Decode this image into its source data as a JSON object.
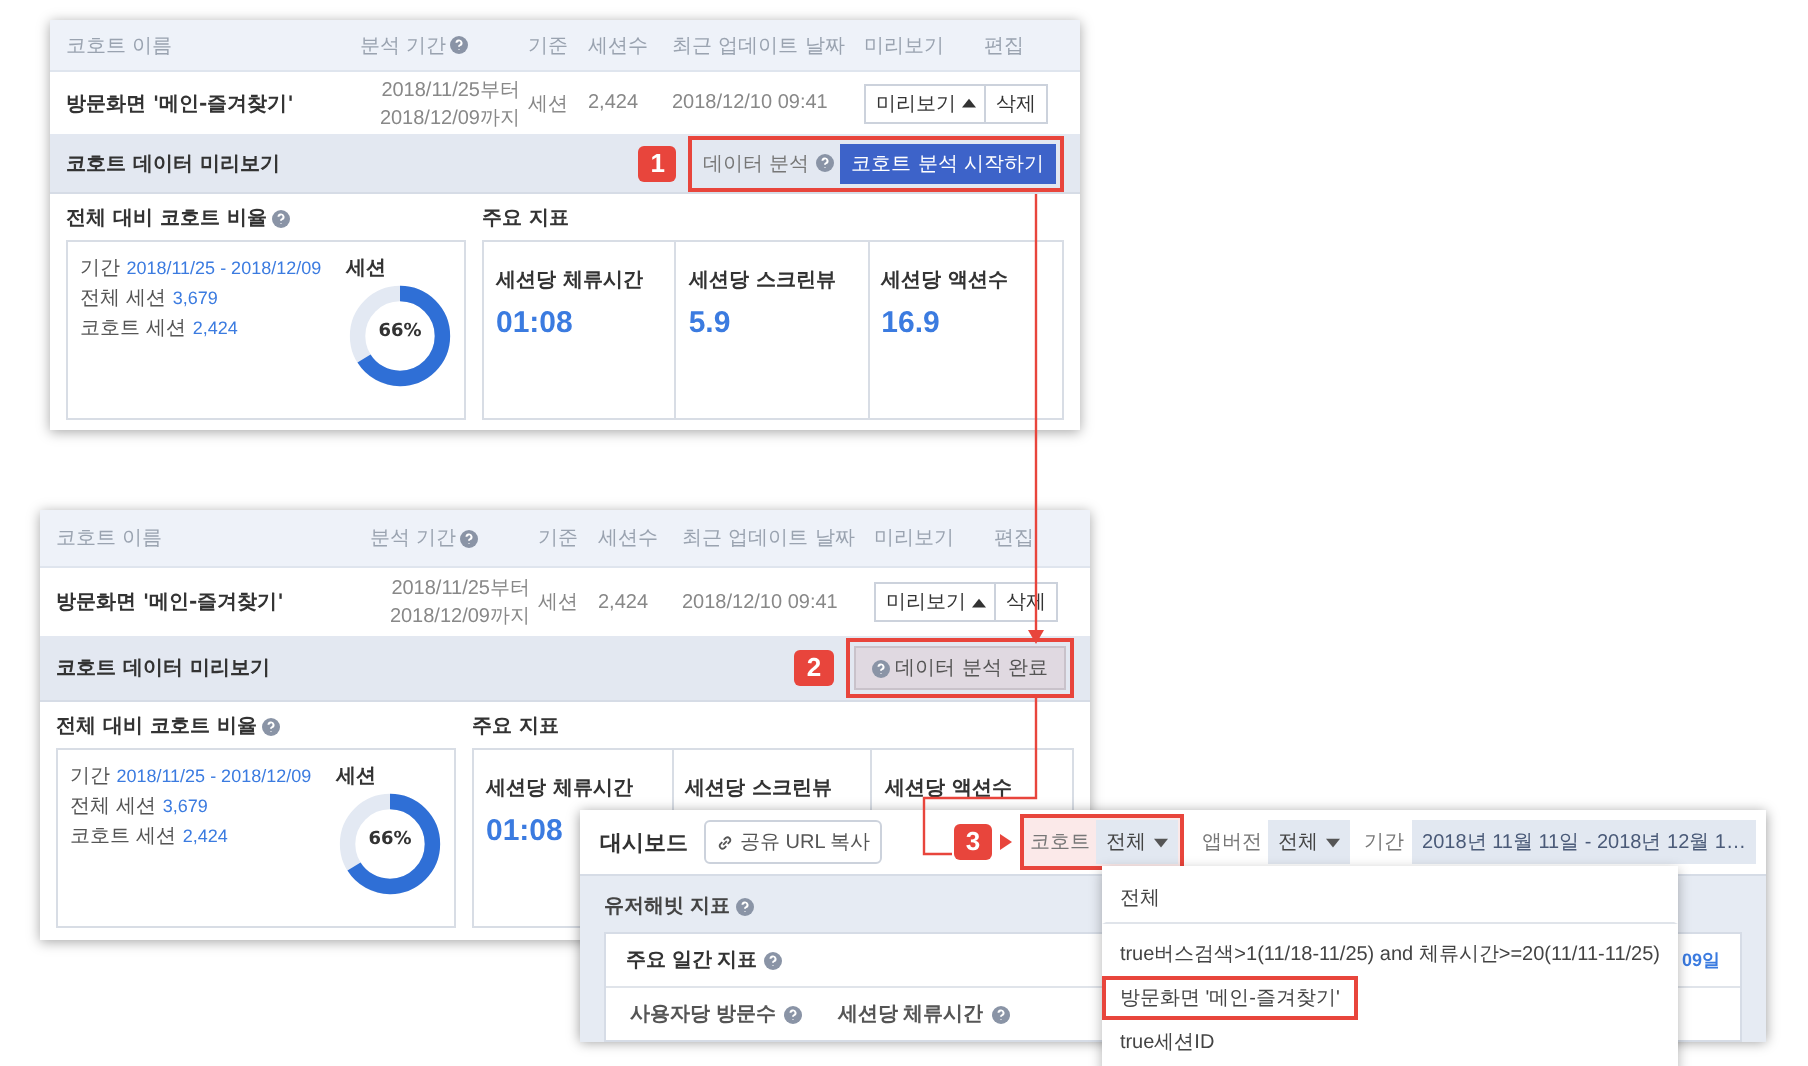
{
  "cohort_panels": [
    {
      "columns": [
        {
          "label": "코호트 이름",
          "help": false
        },
        {
          "label": "분석 기간",
          "help": true
        },
        {
          "label": "기준",
          "help": false
        },
        {
          "label": "세션수",
          "help": false
        },
        {
          "label": "최근 업데이트 날짜",
          "help": false
        },
        {
          "label": "미리보기",
          "help": false
        },
        {
          "label": "편집",
          "help": false
        }
      ],
      "row": {
        "name": "방문화면 '메인-즐겨찾기'",
        "period": [
          "2018/11/25부터",
          "2018/12/09까지"
        ],
        "basis": "세션",
        "sessions": "2,424",
        "updated": "2018/12/10 09:41",
        "preview_button": "미리보기",
        "delete_button": "삭제"
      },
      "section_title": "코호트 데이터 미리보기",
      "step": "1",
      "action": {
        "kind": "start",
        "label": "데이터 분석",
        "button": "코호트 분석 시작하기",
        "highlighted": true
      },
      "ratio": {
        "title": "전체 대비 코호트 비율",
        "period_label": "기간",
        "period": "2018/11/25 - 2018/12/09",
        "total_label": "전체 세션",
        "total": "3,679",
        "cohort_label": "코호트 세션",
        "cohort": "2,424",
        "chart_title": "세션",
        "level": 0.66,
        "percent": "66%"
      },
      "metrics_title": "주요 지표",
      "metrics": [
        {
          "label": "세션당 체류시간",
          "value": "01:08"
        },
        {
          "label": "세션당 스크린뷰",
          "value": "5.9"
        },
        {
          "label": "세션당 액션수",
          "value": "16.9"
        }
      ]
    },
    {
      "columns": [
        {
          "label": "코호트 이름",
          "help": false
        },
        {
          "label": "분석 기간",
          "help": true
        },
        {
          "label": "기준",
          "help": false
        },
        {
          "label": "세션수",
          "help": false
        },
        {
          "label": "최근 업데이트 날짜",
          "help": false
        },
        {
          "label": "미리보기",
          "help": false
        },
        {
          "label": "편집",
          "help": false
        }
      ],
      "row": {
        "name": "방문화면 '메인-즐겨찾기'",
        "period": [
          "2018/11/25부터",
          "2018/12/09까지"
        ],
        "basis": "세션",
        "sessions": "2,424",
        "updated": "2018/12/10 09:41",
        "preview_button": "미리보기",
        "delete_button": "삭제"
      },
      "section_title": "코호트 데이터 미리보기",
      "step": "2",
      "action": {
        "kind": "done",
        "button": "데이터 분석 완료",
        "highlighted": true
      },
      "ratio": {
        "title": "전체 대비 코호트 비율",
        "period_label": "기간",
        "period": "2018/11/25 - 2018/12/09",
        "total_label": "전체 세션",
        "total": "3,679",
        "cohort_label": "코호트 세션",
        "cohort": "2,424",
        "chart_title": "세션",
        "level": 0.66,
        "percent": "66%"
      },
      "metrics_title": "주요 지표",
      "metrics": [
        {
          "label": "세션당 체류시간",
          "value": "01:08"
        },
        {
          "label": "세션당 스크린뷰"
        },
        {
          "label": "세션당 액션수"
        }
      ]
    }
  ],
  "dashboard": {
    "title": "대시보드",
    "share_button": "공유 URL 복사",
    "step": "3",
    "filters": [
      {
        "label": "코호트",
        "value": "전체",
        "highlighted": true
      },
      {
        "label": "앱버전",
        "value": "전체",
        "highlighted": false
      }
    ],
    "period_label": "기간",
    "period": "2018년 11월 11일 - 2018년 12월 1…",
    "section_title": "유저해빗 지표",
    "card_title": "주요 일간 지표",
    "card_date": "09일",
    "columns": [
      "사용자당 방문수",
      "세션당 체류시간"
    ],
    "menu": [
      {
        "kind": "all",
        "label": "전체",
        "highlighted": false
      },
      {
        "kind": "option",
        "label": "true버스검색>1(11/18-11/25) and 체류시간>=20(11/11-11/25)",
        "highlighted": false
      },
      {
        "kind": "option",
        "label": "방문화면 '메인-즐겨찾기'",
        "highlighted": true
      },
      {
        "kind": "option",
        "label": "true세션ID",
        "highlighted": false
      }
    ]
  }
}
